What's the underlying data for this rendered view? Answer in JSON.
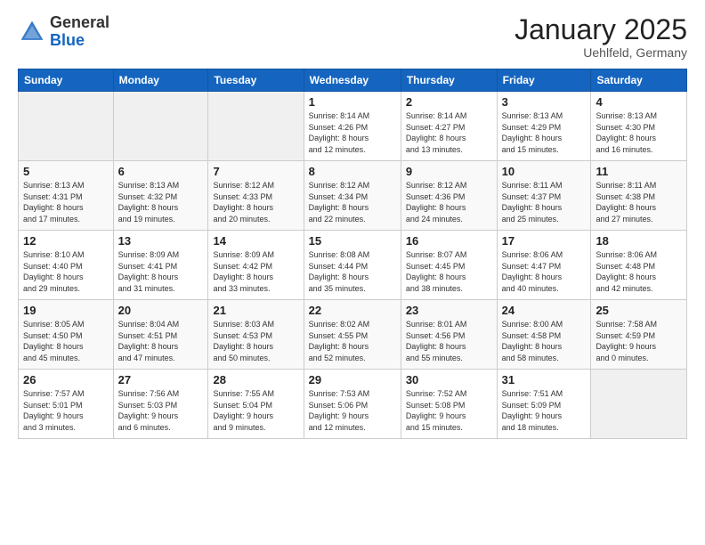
{
  "header": {
    "logo_general": "General",
    "logo_blue": "Blue",
    "month_title": "January 2025",
    "location": "Uehlfeld, Germany"
  },
  "weekdays": [
    "Sunday",
    "Monday",
    "Tuesday",
    "Wednesday",
    "Thursday",
    "Friday",
    "Saturday"
  ],
  "weeks": [
    [
      {
        "day": "",
        "info": ""
      },
      {
        "day": "",
        "info": ""
      },
      {
        "day": "",
        "info": ""
      },
      {
        "day": "1",
        "info": "Sunrise: 8:14 AM\nSunset: 4:26 PM\nDaylight: 8 hours\nand 12 minutes."
      },
      {
        "day": "2",
        "info": "Sunrise: 8:14 AM\nSunset: 4:27 PM\nDaylight: 8 hours\nand 13 minutes."
      },
      {
        "day": "3",
        "info": "Sunrise: 8:13 AM\nSunset: 4:29 PM\nDaylight: 8 hours\nand 15 minutes."
      },
      {
        "day": "4",
        "info": "Sunrise: 8:13 AM\nSunset: 4:30 PM\nDaylight: 8 hours\nand 16 minutes."
      }
    ],
    [
      {
        "day": "5",
        "info": "Sunrise: 8:13 AM\nSunset: 4:31 PM\nDaylight: 8 hours\nand 17 minutes."
      },
      {
        "day": "6",
        "info": "Sunrise: 8:13 AM\nSunset: 4:32 PM\nDaylight: 8 hours\nand 19 minutes."
      },
      {
        "day": "7",
        "info": "Sunrise: 8:12 AM\nSunset: 4:33 PM\nDaylight: 8 hours\nand 20 minutes."
      },
      {
        "day": "8",
        "info": "Sunrise: 8:12 AM\nSunset: 4:34 PM\nDaylight: 8 hours\nand 22 minutes."
      },
      {
        "day": "9",
        "info": "Sunrise: 8:12 AM\nSunset: 4:36 PM\nDaylight: 8 hours\nand 24 minutes."
      },
      {
        "day": "10",
        "info": "Sunrise: 8:11 AM\nSunset: 4:37 PM\nDaylight: 8 hours\nand 25 minutes."
      },
      {
        "day": "11",
        "info": "Sunrise: 8:11 AM\nSunset: 4:38 PM\nDaylight: 8 hours\nand 27 minutes."
      }
    ],
    [
      {
        "day": "12",
        "info": "Sunrise: 8:10 AM\nSunset: 4:40 PM\nDaylight: 8 hours\nand 29 minutes."
      },
      {
        "day": "13",
        "info": "Sunrise: 8:09 AM\nSunset: 4:41 PM\nDaylight: 8 hours\nand 31 minutes."
      },
      {
        "day": "14",
        "info": "Sunrise: 8:09 AM\nSunset: 4:42 PM\nDaylight: 8 hours\nand 33 minutes."
      },
      {
        "day": "15",
        "info": "Sunrise: 8:08 AM\nSunset: 4:44 PM\nDaylight: 8 hours\nand 35 minutes."
      },
      {
        "day": "16",
        "info": "Sunrise: 8:07 AM\nSunset: 4:45 PM\nDaylight: 8 hours\nand 38 minutes."
      },
      {
        "day": "17",
        "info": "Sunrise: 8:06 AM\nSunset: 4:47 PM\nDaylight: 8 hours\nand 40 minutes."
      },
      {
        "day": "18",
        "info": "Sunrise: 8:06 AM\nSunset: 4:48 PM\nDaylight: 8 hours\nand 42 minutes."
      }
    ],
    [
      {
        "day": "19",
        "info": "Sunrise: 8:05 AM\nSunset: 4:50 PM\nDaylight: 8 hours\nand 45 minutes."
      },
      {
        "day": "20",
        "info": "Sunrise: 8:04 AM\nSunset: 4:51 PM\nDaylight: 8 hours\nand 47 minutes."
      },
      {
        "day": "21",
        "info": "Sunrise: 8:03 AM\nSunset: 4:53 PM\nDaylight: 8 hours\nand 50 minutes."
      },
      {
        "day": "22",
        "info": "Sunrise: 8:02 AM\nSunset: 4:55 PM\nDaylight: 8 hours\nand 52 minutes."
      },
      {
        "day": "23",
        "info": "Sunrise: 8:01 AM\nSunset: 4:56 PM\nDaylight: 8 hours\nand 55 minutes."
      },
      {
        "day": "24",
        "info": "Sunrise: 8:00 AM\nSunset: 4:58 PM\nDaylight: 8 hours\nand 58 minutes."
      },
      {
        "day": "25",
        "info": "Sunrise: 7:58 AM\nSunset: 4:59 PM\nDaylight: 9 hours\nand 0 minutes."
      }
    ],
    [
      {
        "day": "26",
        "info": "Sunrise: 7:57 AM\nSunset: 5:01 PM\nDaylight: 9 hours\nand 3 minutes."
      },
      {
        "day": "27",
        "info": "Sunrise: 7:56 AM\nSunset: 5:03 PM\nDaylight: 9 hours\nand 6 minutes."
      },
      {
        "day": "28",
        "info": "Sunrise: 7:55 AM\nSunset: 5:04 PM\nDaylight: 9 hours\nand 9 minutes."
      },
      {
        "day": "29",
        "info": "Sunrise: 7:53 AM\nSunset: 5:06 PM\nDaylight: 9 hours\nand 12 minutes."
      },
      {
        "day": "30",
        "info": "Sunrise: 7:52 AM\nSunset: 5:08 PM\nDaylight: 9 hours\nand 15 minutes."
      },
      {
        "day": "31",
        "info": "Sunrise: 7:51 AM\nSunset: 5:09 PM\nDaylight: 9 hours\nand 18 minutes."
      },
      {
        "day": "",
        "info": ""
      }
    ]
  ]
}
